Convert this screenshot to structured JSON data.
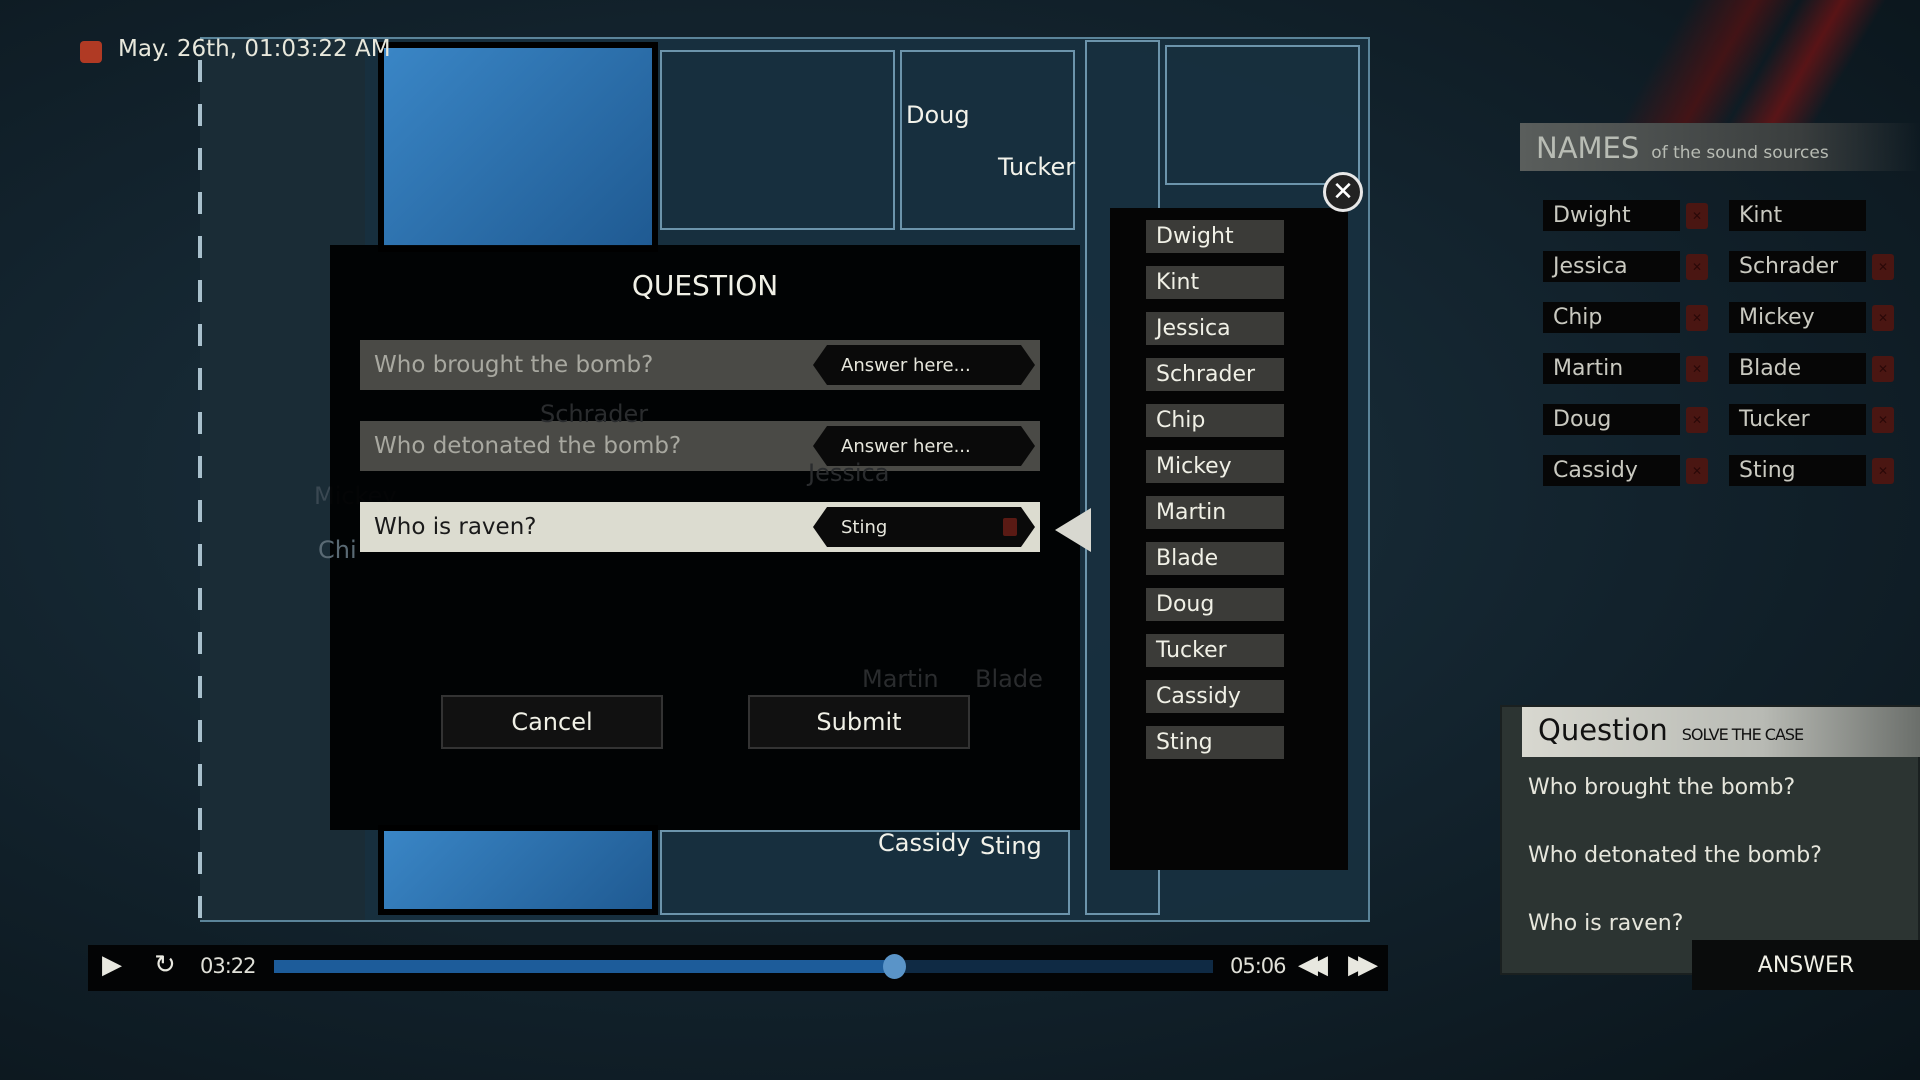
{
  "recording": {
    "timestamp": "May. 26th, 01:03:22 AM",
    "indicator_color": "#b03a24"
  },
  "map": {
    "labels": [
      "Doug",
      "Tucker",
      "Cassidy",
      "Sting"
    ],
    "faded_labels": [
      "Schrader",
      "Jessica",
      "Mickey",
      "Martin",
      "Blade",
      "Chi"
    ]
  },
  "dialog": {
    "title": "QUESTION",
    "rows": [
      {
        "question": "Who brought the bomb?",
        "answer": "",
        "placeholder": "Answer here..."
      },
      {
        "question": "Who detonated the bomb?",
        "answer": "",
        "placeholder": "Answer here..."
      },
      {
        "question": "Who is raven?",
        "answer": "Sting",
        "placeholder": "Answer here...",
        "active": true
      }
    ],
    "cancel_label": "Cancel",
    "submit_label": "Submit"
  },
  "name_picker": {
    "items": [
      "Dwight",
      "Kint",
      "Jessica",
      "Schrader",
      "Chip",
      "Mickey",
      "Martin",
      "Blade",
      "Doug",
      "Tucker",
      "Cassidy",
      "Sting"
    ],
    "close_icon": "close-icon"
  },
  "names_panel": {
    "title": "NAMES",
    "subtitle": "of the sound sources",
    "names": [
      {
        "name": "Dwight",
        "deletable": true
      },
      {
        "name": "Kint",
        "deletable": false
      },
      {
        "name": "Jessica",
        "deletable": true
      },
      {
        "name": "Schrader",
        "deletable": true
      },
      {
        "name": "Chip",
        "deletable": true
      },
      {
        "name": "Mickey",
        "deletable": true
      },
      {
        "name": "Martin",
        "deletable": true
      },
      {
        "name": "Blade",
        "deletable": true
      },
      {
        "name": "Doug",
        "deletable": true
      },
      {
        "name": "Tucker",
        "deletable": true
      },
      {
        "name": "Cassidy",
        "deletable": true
      },
      {
        "name": "Sting",
        "deletable": true
      }
    ]
  },
  "question_panel": {
    "title": "Question",
    "subtitle": "SOLVE THE CASE",
    "questions": [
      "Who brought the bomb?",
      "Who detonated the bomb?",
      "Who is raven?"
    ],
    "answer_label": "ANSWER"
  },
  "player": {
    "current_time": "03:22",
    "total_time": "05:06",
    "progress": 0.66,
    "accent": "#1d5c9a"
  }
}
